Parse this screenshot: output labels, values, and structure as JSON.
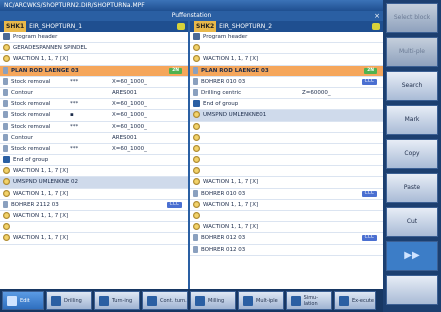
{
  "window": {
    "title": "NC/ARCWKS/ShOPTURN2.DIR/SHOPTURNa.MPF",
    "panel_title": "Puffenstation",
    "close": "×"
  },
  "left_pane": {
    "tag": "SHK1",
    "name": "EIR_SHOPTURN_1",
    "rows": [
      {
        "icon": "pg",
        "text": "Program header",
        "c2": "",
        "c3": "",
        "badge": "",
        "style": ""
      },
      {
        "icon": "gear",
        "text": "GERADESPANNEN SPINDEL",
        "c2": "",
        "c3": "",
        "badge": "",
        "style": ""
      },
      {
        "icon": "gear",
        "text": "WACTION 1, 1, 7 [X]",
        "c2": "",
        "c3": "",
        "badge": "",
        "style": ""
      },
      {
        "icon": "tool",
        "text": "PLAN ROD LAENGE 03",
        "c2": "",
        "c3": "",
        "badge": "2N",
        "style": "sel"
      },
      {
        "icon": "tool",
        "text": "Stock removal",
        "c2": "***",
        "c3": "X=60_1000_",
        "badge": "",
        "style": ""
      },
      {
        "icon": "tool",
        "text": "Contour",
        "c2": "",
        "c3": "ARES001",
        "badge": "",
        "style": ""
      },
      {
        "icon": "tool",
        "text": "Stock removal",
        "c2": "***",
        "c3": "X=60_1000_",
        "badge": "",
        "style": ""
      },
      {
        "icon": "tool",
        "text": "Stock removal",
        "c2": "▪",
        "c3": "X=60_1000_",
        "badge": "",
        "style": ""
      },
      {
        "icon": "tool",
        "text": "Stock removal",
        "c2": "***",
        "c3": "X=60_1000_",
        "badge": "",
        "style": ""
      },
      {
        "icon": "tool",
        "text": "Contour",
        "c2": "",
        "c3": "ARES001",
        "badge": "",
        "style": ""
      },
      {
        "icon": "tool",
        "text": "Stock removal",
        "c2": "***",
        "c3": "X=60_1000_",
        "badge": "",
        "style": ""
      },
      {
        "icon": "grp",
        "text": "End of group",
        "c2": "",
        "c3": "",
        "badge": "",
        "style": ""
      },
      {
        "icon": "gear",
        "text": "WACTION 1, 1, 7 [X]",
        "c2": "",
        "c3": "",
        "badge": "",
        "style": ""
      },
      {
        "icon": "gear",
        "text": "UMSPND UMLENKNE 02",
        "c2": "",
        "c3": "",
        "badge": "",
        "style": "blue"
      },
      {
        "icon": "gear",
        "text": "WACTION 1, 1, 7 [X]",
        "c2": "",
        "c3": "",
        "badge": "",
        "style": ""
      },
      {
        "icon": "tool",
        "text": "BOHRER 2112 03",
        "c2": "",
        "c3": "",
        "badge": "CCC",
        "style": ""
      },
      {
        "icon": "gear",
        "text": "WACTION 1, 1, 7 [X]",
        "c2": "",
        "c3": "",
        "badge": "",
        "style": ""
      },
      {
        "icon": "gear",
        "text": "",
        "c2": "",
        "c3": "",
        "badge": "",
        "style": ""
      },
      {
        "icon": "gear",
        "text": "WACTION 1, 1, 7 [X]",
        "c2": "",
        "c3": "",
        "badge": "",
        "style": ""
      }
    ]
  },
  "right_pane": {
    "tag": "SHK2",
    "name": "EIR_SHOPTURN_2",
    "rows": [
      {
        "icon": "pg",
        "text": "Program header",
        "c2": "",
        "c3": "",
        "badge": "",
        "style": ""
      },
      {
        "icon": "gear",
        "text": "",
        "c2": "",
        "c3": "",
        "badge": "",
        "style": ""
      },
      {
        "icon": "gear",
        "text": "WACTION 1, 1, 7 [X]",
        "c2": "",
        "c3": "",
        "badge": "",
        "style": ""
      },
      {
        "icon": "tool",
        "text": "PLAN ROD LAENGE 03",
        "c2": "",
        "c3": "",
        "badge": "2N",
        "style": "sel"
      },
      {
        "icon": "tool",
        "text": "BOHRER 010 03",
        "c2": "",
        "c3": "",
        "badge": "CCC",
        "style": ""
      },
      {
        "icon": "tool",
        "text": "Drilling centric",
        "c2": "",
        "c3": "Z=60000_",
        "badge": "",
        "style": ""
      },
      {
        "icon": "grp",
        "text": "End of group",
        "c2": "",
        "c3": "",
        "badge": "",
        "style": ""
      },
      {
        "icon": "gear",
        "text": "UMSPND UMLENKNE01",
        "c2": "",
        "c3": "",
        "badge": "",
        "style": "blue"
      },
      {
        "icon": "gear",
        "text": "",
        "c2": "",
        "c3": "",
        "badge": "",
        "style": ""
      },
      {
        "icon": "gear",
        "text": "",
        "c2": "",
        "c3": "",
        "badge": "",
        "style": ""
      },
      {
        "icon": "gear",
        "text": "",
        "c2": "",
        "c3": "",
        "badge": "",
        "style": ""
      },
      {
        "icon": "gear",
        "text": "",
        "c2": "",
        "c3": "",
        "badge": "",
        "style": ""
      },
      {
        "icon": "gear",
        "text": "",
        "c2": "",
        "c3": "",
        "badge": "",
        "style": ""
      },
      {
        "icon": "gear",
        "text": "WACTION 1, 1, 7 [X]",
        "c2": "",
        "c3": "",
        "badge": "",
        "style": ""
      },
      {
        "icon": "tool",
        "text": "BOHRER 010 03",
        "c2": "",
        "c3": "",
        "badge": "CCC",
        "style": ""
      },
      {
        "icon": "gear",
        "text": "WACTION 1, 1, 7 [X]",
        "c2": "",
        "c3": "",
        "badge": "",
        "style": ""
      },
      {
        "icon": "gear",
        "text": "",
        "c2": "",
        "c3": "",
        "badge": "",
        "style": ""
      },
      {
        "icon": "gear",
        "text": "WACTION 1, 1, 7 [X]",
        "c2": "",
        "c3": "",
        "badge": "",
        "style": ""
      },
      {
        "icon": "tool",
        "text": "BOHRER 012 03",
        "c2": "",
        "c3": "",
        "badge": "CCC",
        "style": ""
      },
      {
        "icon": "tool",
        "text": "BOHRER 012 03",
        "c2": "",
        "c3": "",
        "badge": "",
        "style": ""
      }
    ]
  },
  "side_buttons": [
    {
      "label": "Select block",
      "state": "dis"
    },
    {
      "label": "Multi-ple",
      "state": "dis"
    },
    {
      "label": "Search",
      "state": ""
    },
    {
      "label": "Mark",
      "state": ""
    },
    {
      "label": "Copy",
      "state": ""
    },
    {
      "label": "Paste",
      "state": ""
    },
    {
      "label": "Cut",
      "state": ""
    },
    {
      "label": "▶▶",
      "state": "ar"
    },
    {
      "label": "",
      "state": ""
    }
  ],
  "bottom_buttons": [
    {
      "label": "Edit",
      "state": "act"
    },
    {
      "label": "Drilling",
      "state": ""
    },
    {
      "label": "Turn-ing",
      "state": ""
    },
    {
      "label": "Cont. turn.",
      "state": ""
    },
    {
      "label": "Milling",
      "state": ""
    },
    {
      "label": "Mult-iple",
      "state": ""
    },
    {
      "label": "Simu-lation",
      "state": ""
    },
    {
      "label": "Ex-ecute",
      "state": ""
    }
  ]
}
